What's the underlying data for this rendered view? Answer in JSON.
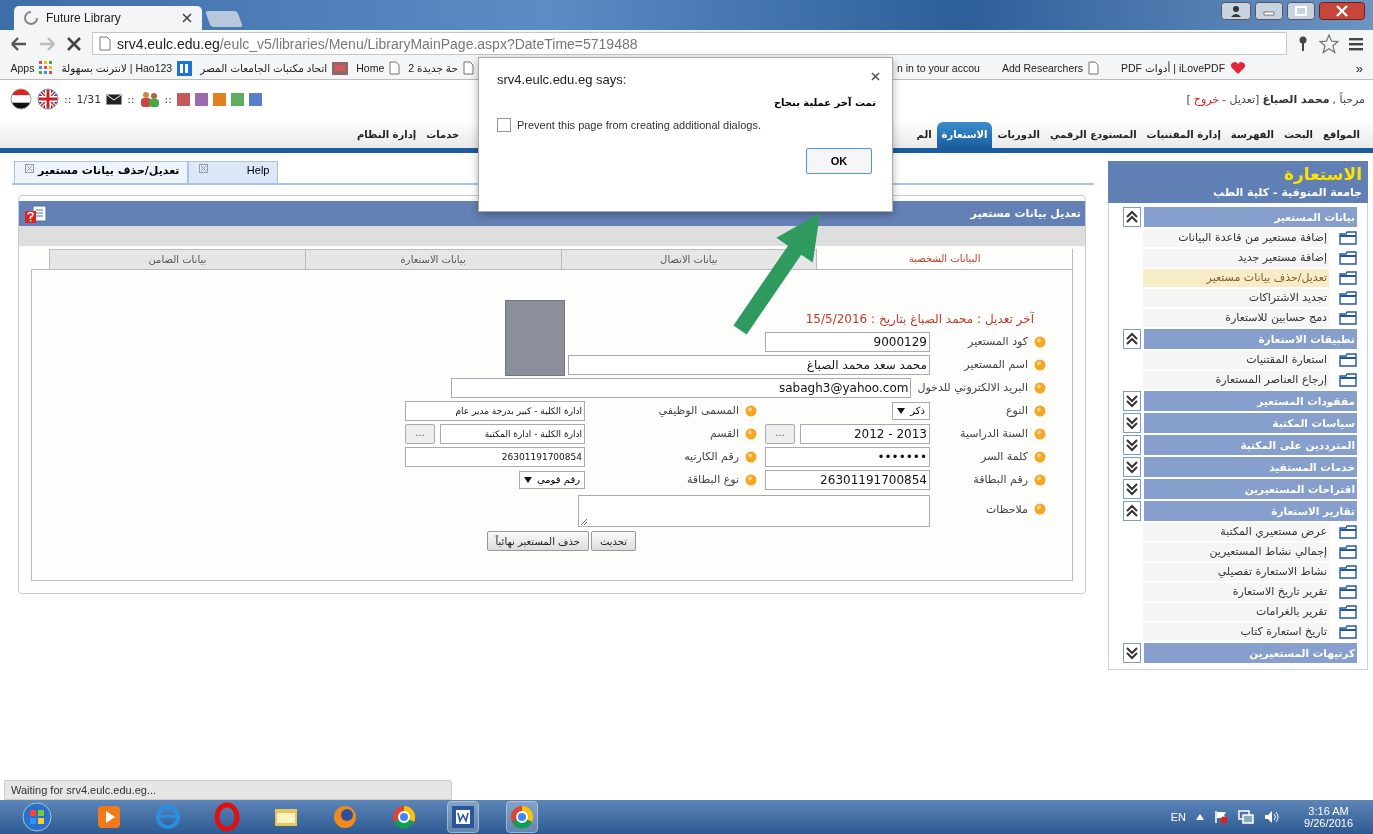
{
  "browser": {
    "tab_title": "Future Library",
    "url_host": "srv4.eulc.edu.eg",
    "url_path": "/eulc_v5/libraries/Menu/LibraryMainPage.aspx?DateTime=5719488",
    "bookmarks": [
      {
        "label": "حة جديدة 2",
        "kind": "page"
      },
      {
        "label": "Home",
        "kind": "page"
      },
      {
        "label": "اتحاد مكتبات الجامعات المصر",
        "kind": "fs"
      },
      {
        "label": "Hao123 | لانترنت بسهولة",
        "kind": "hao"
      },
      {
        "label": "Apps",
        "kind": "apps"
      }
    ],
    "bookmarks_right": [
      {
        "label": "iLovePDF | أدوات PDF",
        "kind": "heart"
      },
      {
        "label": "Add Researchers",
        "kind": "page"
      },
      {
        "label": "n in to your accou",
        "kind": "none"
      }
    ],
    "more": "»",
    "status": "Waiting for srv4.eulc.edu.eg..."
  },
  "top": {
    "separator": "::",
    "messages": "1/31",
    "swatches": [
      {
        "color": "#c65a5a"
      },
      {
        "color": "#9a6bb0"
      },
      {
        "color": "#e3801f"
      },
      {
        "color": "#5fad5f"
      },
      {
        "color": "#5b7ec9"
      }
    ],
    "welcome": "مرحباً ,",
    "user": "محمد الصباغ",
    "edit": "[تعديل -",
    "logout": "خروج",
    "close": "]"
  },
  "nav": [
    {
      "label": "المواقع",
      "selected": false
    },
    {
      "label": "البحث",
      "selected": false
    },
    {
      "label": "الفهرسة",
      "selected": false
    },
    {
      "label": "إدارة المقتنيات",
      "selected": false
    },
    {
      "label": "المستودع الرقمي",
      "selected": false
    },
    {
      "label": "الدوريات",
      "selected": false
    },
    {
      "label": "الاستعارة",
      "selected": true
    },
    {
      "label": "الم",
      "selected": false
    }
  ],
  "nav_left": [
    {
      "label": "خدمات",
      "selected": false
    },
    {
      "label": "إدارة النظام",
      "selected": false
    }
  ],
  "doc_tabs": [
    {
      "label": "Help",
      "selected": false
    },
    {
      "label": "تعديل/حذف بيانات مستعير",
      "selected": true
    }
  ],
  "panel": {
    "title": "تعديل بيانات مستعير",
    "subtabs": [
      {
        "label": "البيانات الشخصية",
        "selected": true
      },
      {
        "label": "بيانات الاتصال",
        "selected": false
      },
      {
        "label": "بيانات الاستعارة",
        "selected": false
      },
      {
        "label": "بيانات الضامن",
        "selected": false
      }
    ],
    "last_edit": "آخر تعديل : محمد الصباغ بتاريخ : 15/5/2016",
    "top_rows": [
      {
        "fields": [
          {
            "label": "كود المستعير",
            "value": "9000129",
            "kind": "text"
          }
        ]
      },
      {
        "fields": [
          {
            "label": "اسم المستعير",
            "value": "محمد سعد محمد الصباغ",
            "kind": "wide"
          }
        ]
      }
    ],
    "rows": [
      {
        "fields": [
          {
            "label": "البريد الالكتروني للدخول",
            "value": "sabagh3@yahoo.com",
            "kind": "wider"
          }
        ]
      },
      {
        "fields": [
          {
            "label": "النوع",
            "value": "ذكر",
            "kind": "select"
          },
          {
            "label": "المسمى الوظيفي",
            "value": "ادارة الكلية - كبير بدرجة مدير  عام",
            "kind": "text"
          }
        ]
      },
      {
        "fields": [
          {
            "label": "السنة الدراسية",
            "value": "2013 - 2012",
            "kind": "text",
            "picker": "..."
          },
          {
            "label": "القسم",
            "value": "ادارة الكلية - ادارة المكتبة",
            "kind": "text",
            "picker": "..."
          }
        ]
      },
      {
        "fields": [
          {
            "label": "كلمة السر",
            "value": "•••••••",
            "kind": "text"
          },
          {
            "label": "رقم الكارنيه",
            "value": "26301191700854",
            "kind": "text"
          }
        ]
      },
      {
        "fields": [
          {
            "label": "رقم البطاقة",
            "value": "26301191700854",
            "kind": "text"
          },
          {
            "label": "نوع البطاقة",
            "value": "رقم قومي",
            "kind": "select"
          }
        ]
      },
      {
        "fields": [
          {
            "label": "ملاحظات",
            "kind": "textarea"
          }
        ]
      }
    ],
    "buttons": [
      "تحديث",
      "حذف المستعير نهائياً"
    ]
  },
  "sidebar": {
    "title": "الاستعارة",
    "subtitle": "جامعة المنوفية - كلية الطب",
    "sections": [
      {
        "title": "بيانات المستعير",
        "expanded": true,
        "items": [
          {
            "label": "إضافة مستعير من قاعدة البيانات",
            "selected": false
          },
          {
            "label": "إضافة مستعير جديد",
            "selected": false
          },
          {
            "label": "تعديل/حذف بيانات مستعير",
            "selected": true
          },
          {
            "label": "تجديد الاشتراكات",
            "selected": false
          },
          {
            "label": "دمج حسابين للاستعارة",
            "selected": false
          }
        ]
      },
      {
        "title": "تطبيقات الاستعارة",
        "expanded": true,
        "items": [
          {
            "label": "استعارة المقتنيات",
            "selected": false
          },
          {
            "label": "إرجاع العناصر المستعارة",
            "selected": false
          }
        ]
      },
      {
        "title": "مفقودات المستعير",
        "expanded": false
      },
      {
        "title": "سياسات المكتبة",
        "expanded": false
      },
      {
        "title": "المترددين على المكتبة",
        "expanded": false
      },
      {
        "title": "خدمات المستفيد",
        "expanded": false
      },
      {
        "title": "اقتراحات المستعيرين",
        "expanded": false
      },
      {
        "title": "تقارير الاستعارة",
        "expanded": true,
        "items": [
          {
            "label": "عرض مستعيري المكتبة",
            "selected": false
          },
          {
            "label": "إجمالي نشاط المستعيرين",
            "selected": false
          },
          {
            "label": "نشاط الاستعارة تفصيلي",
            "selected": false
          },
          {
            "label": "تقرير تاريخ الاستعارة",
            "selected": false
          },
          {
            "label": "تقرير بالغرامات",
            "selected": false
          },
          {
            "label": "تاريخ استعارة كتاب",
            "selected": false
          }
        ]
      },
      {
        "title": "كرتيهات المستعيرين",
        "expanded": false
      }
    ]
  },
  "dialog": {
    "title": "srv4.eulc.edu.eg says:",
    "message": "تمت آخر عملية بنجاح",
    "checkbox": {
      "label": "Prevent this page from creating additional dialogs.",
      "checked": false
    },
    "button": "OK"
  },
  "taskbar": {
    "language": "EN",
    "time": "3:16 AM",
    "date": "9/26/2016"
  }
}
